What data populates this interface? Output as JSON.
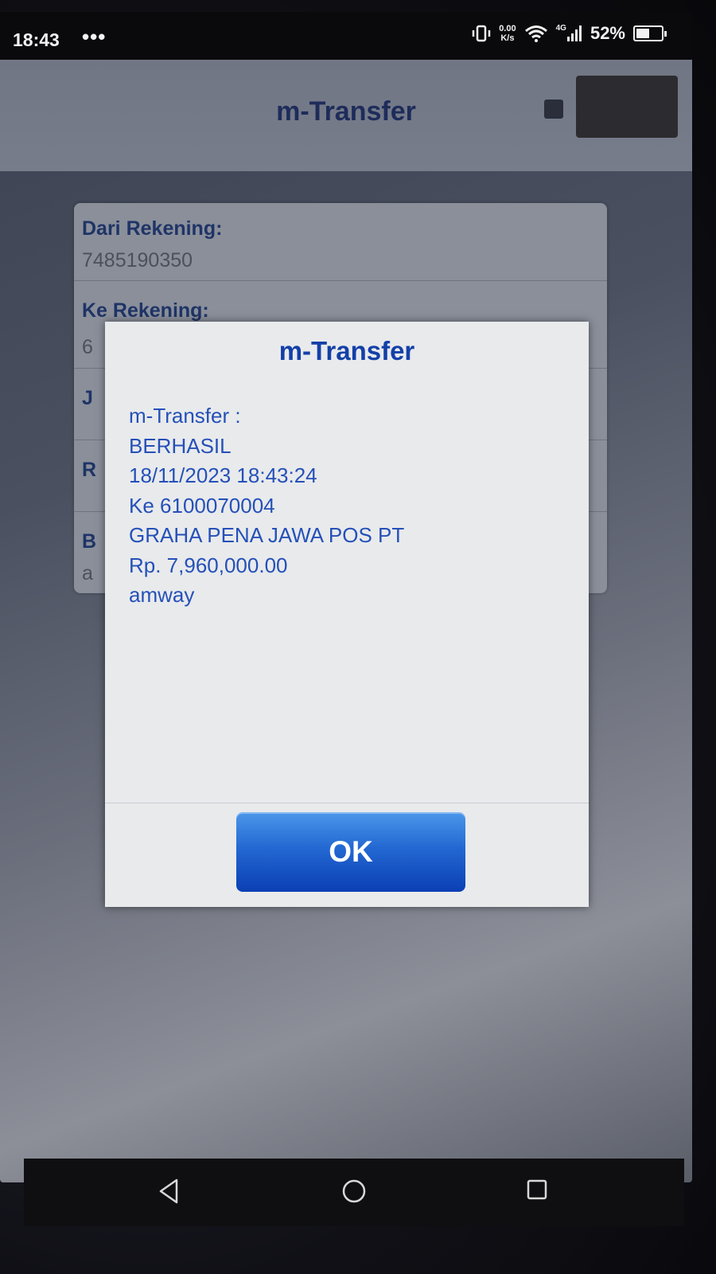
{
  "status_bar": {
    "time": "18:43",
    "dots": "•••",
    "speed_value": "0.00",
    "speed_unit": "K/s",
    "network": "4G",
    "battery_percent": "52%",
    "battery_level": 0.52
  },
  "app_bar": {
    "title": "m-Transfer"
  },
  "form": {
    "from_account_label": "Dari Rekening:",
    "from_account_value": "7485190350",
    "to_account_label": "Ke Rekening:",
    "to_account_value_partial": "6",
    "row3_label_partial": "J",
    "row4_label_partial": "R",
    "row5_label_partial": "B",
    "row5_value_partial": "a"
  },
  "dialog": {
    "title": "m-Transfer",
    "lines": [
      "m-Transfer :",
      "BERHASIL",
      "18/11/2023 18:43:24",
      "Ke 6100070004",
      "GRAHA PENA JAWA POS PT",
      "Rp. 7,960,000.00",
      "amway"
    ],
    "ok_label": "OK"
  },
  "nav_bar": {
    "back_icon": "back-triangle-icon",
    "home_icon": "home-circle-icon",
    "recents_icon": "recents-square-icon"
  }
}
